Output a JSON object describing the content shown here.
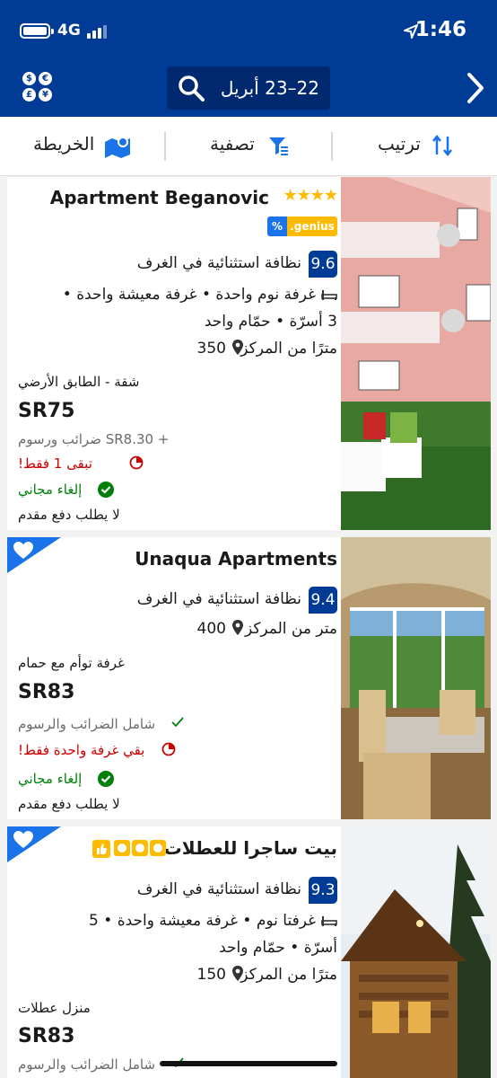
{
  "status": {
    "network": "4G",
    "time": "1:46"
  },
  "header": {
    "dates": "22–23 أبريل",
    "currency_icons": [
      "$",
      "€",
      "£",
      "¥"
    ]
  },
  "sortbar": {
    "sort": "ترتيب",
    "filter": "تصفية",
    "map": "الخريطة"
  },
  "cards": [
    {
      "name": "Apartment Beganovic",
      "stars": "★★★★",
      "genius": ".genius",
      "genius_percent": "%",
      "score": "9.6",
      "score_label": "نظافة استثنائية في الغرف",
      "rooms_line1": "غرفة نوم واحدة • غرفة معيشة واحدة •",
      "rooms_line2": "3 أسرّة • حمّام واحد",
      "distance_num": "350",
      "distance_text": "مترًا من المركز",
      "unit_type": "شقة - الطابق الأرضي",
      "price": "SR75",
      "taxes": "+ SR8.30 ضرائب ورسوم",
      "left": "تبقى 1 فقط!",
      "cancel": "إلغاء مجاني",
      "prepay": "لا يطلب دفع مقدم"
    },
    {
      "name": "Unaqua Apartments",
      "score": "9.4",
      "score_label": "نظافة استثنائية في الغرف",
      "distance_num": "400",
      "distance_text": "متر من المركز",
      "unit_type": "غرفة توأم مع حمام",
      "price": "SR83",
      "taxes": "شامل الضرائب والرسوم",
      "left": "بقي غرفة واحدة فقط!",
      "cancel": "إلغاء مجاني",
      "prepay": "لا يطلب دفع مقدم"
    },
    {
      "name": "بيت ساجرا للعطلات",
      "score": "9.3",
      "score_label": "نظافة استثنائية في الغرف",
      "rooms_line1": "غرفتا نوم • غرفة معيشة واحدة • 5",
      "rooms_line2": "أسرّة • حمّام واحد",
      "distance_num": "150",
      "distance_text": "مترًا من المركز",
      "unit_type": "منزل عطلات",
      "price": "SR83",
      "taxes": "شامل الضرائب والرسوم"
    }
  ],
  "colors": {
    "brand": "#003b95",
    "accent": "#1a73e8",
    "star": "#febb02",
    "green": "#008009",
    "red": "#cc0000"
  }
}
